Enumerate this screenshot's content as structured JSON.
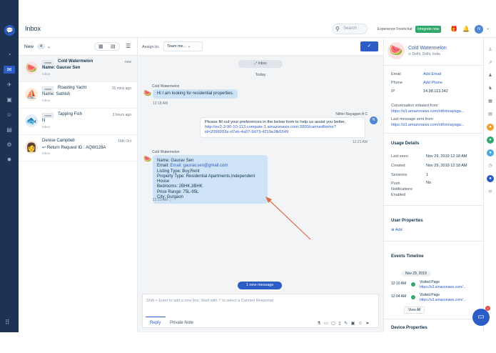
{
  "header": {
    "title": "Inbox",
    "search_placeholder": "Search",
    "experience": "Experience Freshchat",
    "integrate": "Integrate now",
    "avatar": "N"
  },
  "list": {
    "new_label": "New",
    "new_count": "4",
    "conversations": [
      {
        "badge": "visitor",
        "name": "Cold Watermelon",
        "time": "now",
        "sub": "Name: Gaurav Sen",
        "tag": "Inbox",
        "emoji": "🍉"
      },
      {
        "badge": "visitor",
        "name": "Roasting Yacht",
        "time": "20 mins ago",
        "sub": "Name: Sathish",
        "tag": "Inbox",
        "emoji": "⛵"
      },
      {
        "badge": "visitor",
        "name": "Tapping Fish",
        "time": "3 hours ago",
        "sub": "N",
        "tag": "Inbox",
        "emoji": "🐟"
      },
      {
        "badge": "",
        "name": "Denise Campbell",
        "time": "16th Oct",
        "sub": "Return Request ID : AQW128A",
        "tag": "Inbox",
        "emoji": "👩"
      }
    ]
  },
  "chat": {
    "assign_label": "Assign to:",
    "assign_value": "Team me...",
    "inbox_pill": "Inbox",
    "today": "Today",
    "msg1_sender": "Cold Watermelon",
    "msg1_text": "Hi I am looking for residential properties.",
    "msg1_time": "12:18 AM",
    "msg2_sender": "Nithin Nayagam A C",
    "msg2_text": "Please fill out your preferences in the below form to help us assist you better,",
    "msg2_link": "http://ec2-3-90-10-113.compute-1.amazonaws.com:3000/cannedforms?id=2099203e-d7eb-4a07-9d73-4219e2fb5549",
    "msg2_time": "12:21 AM",
    "msg2_avatar": "N",
    "msg3_sender": "Cold Watermelon",
    "msg3_lines": [
      "Name: Gaurav Sen",
      "Email: gaurav.sen@gmail.com",
      "Listing Type: Buy,Rent",
      "Property Type: Residential Apartments,Independent House",
      "Bedrooms: 2BHK,3BHK",
      "Price Range: 75L-95L",
      "City: Gurgaon"
    ],
    "msg3_time": "12:23 AM",
    "new_message": "1 new message",
    "compose_placeholder": "Shift + Enter to add a new line; Start with '/' to select a Canned Response",
    "reply": "Reply",
    "private_note": "Private Note"
  },
  "contact": {
    "name": "Cold Watermelon",
    "location": "Delhi, Delhi, India",
    "email_label": "Email",
    "email_value": "Add Email",
    "phone_label": "Phone",
    "phone_value": "Add Phone",
    "ip_label": "IP",
    "ip_value": "14.98.113.242",
    "conv_init_label": "Conversation initiated from",
    "conv_init_value": "https://s3.amazonaws.com/nithinnayaga...",
    "last_msg_label": "Last message sent from",
    "last_msg_value": "https://s3.amazonaws.com/nithinnayaga...",
    "usage_title": "Usage Details",
    "last_seen_label": "Last seen",
    "last_seen_value": "Nov 29, 2019 12:18 AM",
    "created_label": "Created",
    "created_value": "Nov 29, 2019 12:18 AM",
    "sessions_label": "Sessions",
    "sessions_value": "1",
    "push_label": "Push Notifications Enabled",
    "push_value": "No",
    "user_props": "User Properties",
    "add": "Add",
    "events_title": "Events Timeline",
    "event_date": "Nov 29, 2019",
    "events": [
      {
        "time": "12:10 AM",
        "label": "Visited Page",
        "url": "https://s3.amazonaws.com/..."
      },
      {
        "time": "12:04 AM",
        "label": "Visited Page",
        "url": "https://s3.amazonaws.com/..."
      }
    ],
    "view_all": "View All",
    "device_props": "Device Properties"
  },
  "fab": {
    "badge": "1"
  }
}
